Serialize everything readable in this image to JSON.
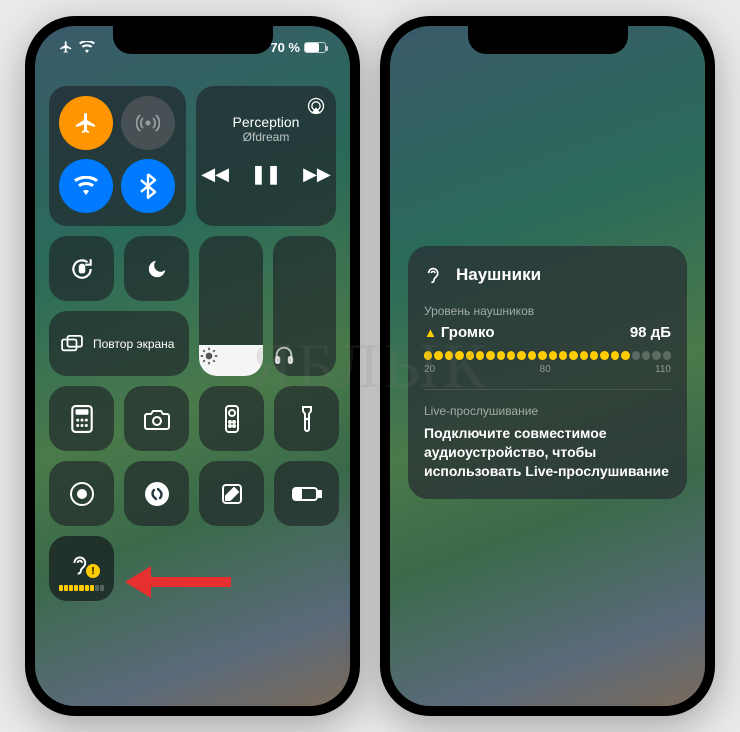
{
  "watermark": "ЯБЛЫК",
  "status": {
    "battery_text": "70 %",
    "battery_percent": 70
  },
  "media": {
    "title": "Perception",
    "artist": "Øfdream"
  },
  "connectivity": {
    "airplane": "airplane-icon",
    "cellular": "cellular-icon",
    "wifi": "wifi-icon",
    "bluetooth": "bluetooth-icon"
  },
  "controls": {
    "orientation_lock": "rotation-lock-icon",
    "dnd": "moon-icon",
    "brightness_percent": 22,
    "volume_percent": 0,
    "screen_mirroring_label": "Повтор экрана"
  },
  "tiles": [
    {
      "name": "calculator-icon"
    },
    {
      "name": "camera-icon"
    },
    {
      "name": "apple-tv-remote-icon"
    },
    {
      "name": "flashlight-icon"
    },
    {
      "name": "screen-record-icon"
    },
    {
      "name": "shazam-icon"
    },
    {
      "name": "notes-icon"
    },
    {
      "name": "low-power-icon"
    }
  ],
  "hearing_tile": {
    "name": "hearing-icon",
    "warning": "!"
  },
  "panel": {
    "header": "Наушники",
    "level_label": "Уровень наушников",
    "level_status": "Громко",
    "level_value": "98 дБ",
    "scale": [
      "20",
      "80",
      "110"
    ],
    "meter_filled": 20,
    "meter_total": 24,
    "live_label": "Live-прослушивание",
    "live_text": "Подключите совместимое аудиоустройство, чтобы использовать Live-прослушивание"
  }
}
